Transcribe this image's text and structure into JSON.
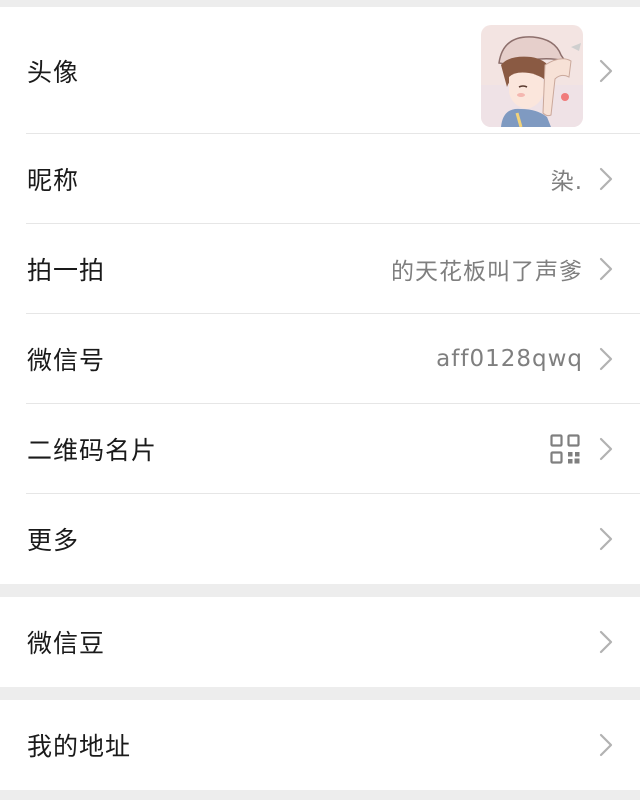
{
  "profile_group": {
    "avatar_label": "头像",
    "nickname_label": "昵称",
    "nickname_value": "染.",
    "pat_label": "拍一拍",
    "pat_value": "的天花板叫了声爹",
    "wechat_id_label": "微信号",
    "wechat_id_value": "aff0128qwq",
    "qr_label": "二维码名片",
    "qr_icon": "qr-code-icon",
    "more_label": "更多"
  },
  "beans_group": {
    "label": "微信豆"
  },
  "address_group": {
    "label": "我的地址"
  },
  "colors": {
    "background": "#ededed",
    "card": "#ffffff",
    "label_text": "#1a1a1a",
    "value_text": "#7f7f7f",
    "chevron": "#b2b2b2"
  }
}
